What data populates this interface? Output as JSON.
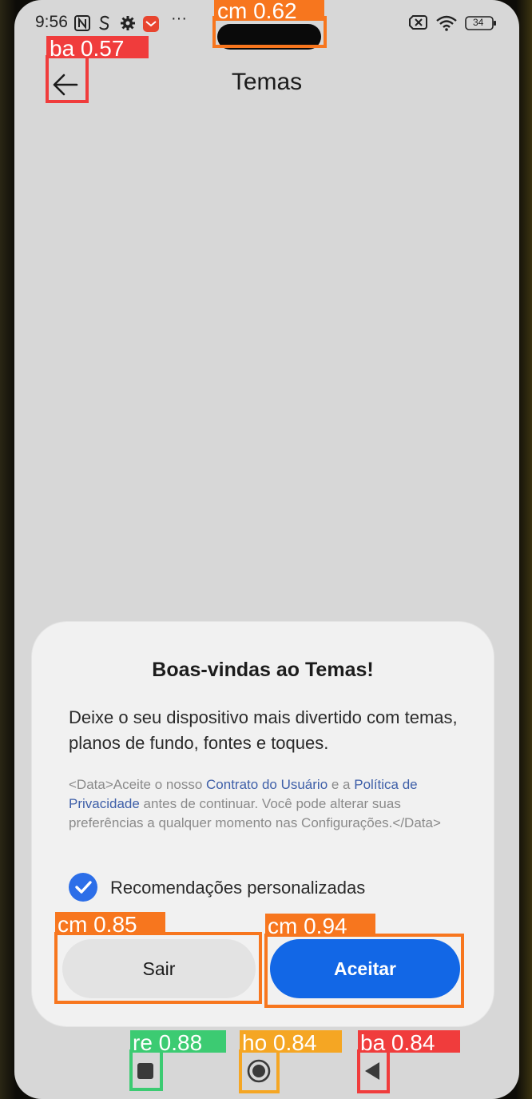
{
  "status_bar": {
    "time": "9:56",
    "left_icons": [
      "nfc-icon",
      "s-app-icon",
      "settings-gear-icon",
      "mail-app-icon",
      "more-notifications-icon"
    ],
    "more": "···",
    "battery": "34"
  },
  "header": {
    "title": "Temas"
  },
  "dialog": {
    "title": "Boas-vindas ao Temas!",
    "body": "Deixe o seu dispositivo mais divertido com temas, planos de fundo, fontes e toques.",
    "legal_prefix": "<Data>Aceite o nosso ",
    "legal_link1": "Contrato do Usuário",
    "legal_mid": " e a ",
    "legal_link2": "Política de Privacidade",
    "legal_suffix": " antes de continuar. Você pode alterar suas preferências a qualquer momento nas Configurações.</Data>",
    "checkbox_label": "Recomendações personalizadas",
    "checkbox_checked": true,
    "button_exit": "Sair",
    "button_accept": "Aceitar"
  },
  "overlay_labels": {
    "notch": "cm 0.62",
    "back_top": "ba 0.57",
    "exit": "cm 0.85",
    "accept": "cm 0.94",
    "recents": "re 0.88",
    "home": "ho 0.84",
    "back_nav": "ba 0.84"
  },
  "colors": {
    "accent": "#1267e6",
    "checkbox": "#2c6ee8",
    "link": "#3e5fa8",
    "box_red": "#f03c3c",
    "box_orange": "#f7761e",
    "box_green": "#3ccb72",
    "box_amber": "#f5a623"
  }
}
